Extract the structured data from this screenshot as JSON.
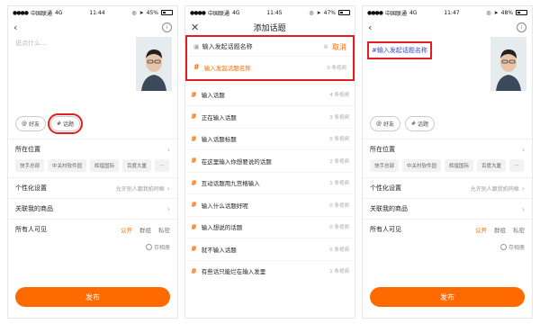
{
  "status_bars": [
    {
      "carrier": "中国联通",
      "network": "4G",
      "time": "11:44",
      "battery": "45%",
      "battery_level": 0.45
    },
    {
      "carrier": "中国联通",
      "network": "4G",
      "time": "11:45",
      "battery": "47%",
      "battery_level": 0.47
    },
    {
      "carrier": "中国联通",
      "network": "4G",
      "time": "11:47",
      "battery": "48%",
      "battery_level": 0.48
    }
  ],
  "colors": {
    "accent": "#ff6a00",
    "highlight": "#e02020",
    "topic_text": "#3b4bbf"
  },
  "screen1": {
    "placeholder": "说点什么...",
    "chip_friend": "好友",
    "chip_topic": "话题",
    "location_label": "所在位置",
    "locations": [
      "快手总部",
      "中关村软件园",
      "辉煌国际",
      "百度大厦",
      "…"
    ],
    "personal_label": "个性化设置",
    "personal_value": "允许别人跟我拍同框",
    "product_label": "关联我的商品",
    "visibility_label": "所有人可见",
    "visibility_options": [
      "公开",
      "群组",
      "私密"
    ],
    "save_album": "存相册",
    "publish": "发布"
  },
  "screen2": {
    "title": "添加话题",
    "search_value": "输入发起话题名称",
    "cancel": "取消",
    "topics": [
      {
        "label": "输入发起话题名称",
        "count": "0 条视频"
      },
      {
        "label": "输入话题",
        "count": "4 条视频"
      },
      {
        "label": "正在输入话题",
        "count": "3 条视频"
      },
      {
        "label": "输入话题标题",
        "count": "0 条视频"
      },
      {
        "label": "在这里输入你想要说的话题",
        "count": "2 条视频"
      },
      {
        "label": "互动话题用九宫格输入",
        "count": "1 条视频"
      },
      {
        "label": "输入什么话题好呢",
        "count": "0 条视频"
      },
      {
        "label": "输入想说的话题",
        "count": "0 条视频"
      },
      {
        "label": "就不输入话题",
        "count": "0 条视频"
      },
      {
        "label": "有些话只能烂在输入发里",
        "count": "1 条视频"
      }
    ]
  },
  "screen3": {
    "topic_text": "#输入发起话题名称",
    "chip_friend": "好友",
    "chip_topic": "话题",
    "location_label": "所在位置",
    "locations": [
      "快手总部",
      "中关村软件园",
      "辉煌国际",
      "百度大厦",
      "…"
    ],
    "personal_label": "个性化设置",
    "personal_value": "允许别人跟我拍同框",
    "product_label": "关联我的商品",
    "visibility_label": "所有人可见",
    "visibility_options": [
      "公开",
      "群组",
      "私密"
    ],
    "save_album": "存相册",
    "publish": "发布"
  }
}
